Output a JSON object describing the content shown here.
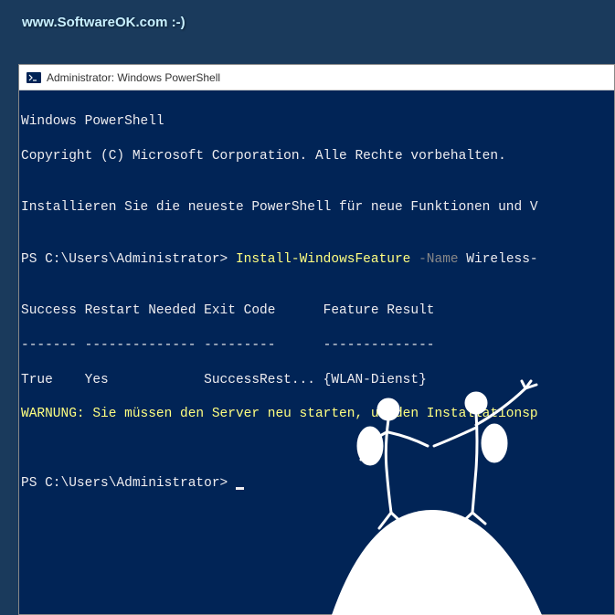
{
  "watermark": "www.SoftwareOK.com :-)",
  "window": {
    "title": "Administrator: Windows PowerShell"
  },
  "terminal": {
    "line1": "Windows PowerShell",
    "line2": "Copyright (C) Microsoft Corporation. Alle Rechte vorbehalten.",
    "line3": "",
    "line4": "Installieren Sie die neueste PowerShell für neue Funktionen und V",
    "line5": "",
    "prompt1": "PS C:\\Users\\Administrator> ",
    "command1": "Install-WindowsFeature",
    "param1": " -Name",
    "arg1": " Wireless-",
    "line7": "",
    "header": "Success Restart Needed Exit Code      Feature Result",
    "separator": "------- -------------- ---------      --------------",
    "result": "True    Yes            SuccessRest... {WLAN-Dienst}",
    "warning": "WARNUNG: Sie müssen den Server neu starten, um den Installationsp",
    "line12": "",
    "line13": "",
    "prompt2": "PS C:\\Users\\Administrator> "
  }
}
